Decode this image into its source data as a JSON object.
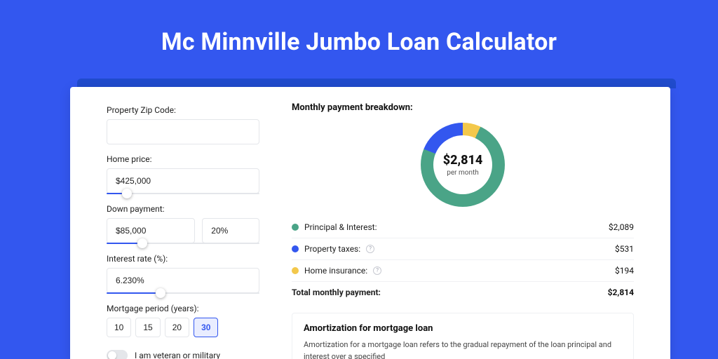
{
  "page_title": "Mc Minnville Jumbo Loan Calculator",
  "form": {
    "zip_label": "Property Zip Code:",
    "zip_value": "",
    "price_label": "Home price:",
    "price_value": "$425,000",
    "down_label": "Down payment:",
    "down_value": "$85,000",
    "down_pct": "20%",
    "rate_label": "Interest rate (%):",
    "rate_value": "6.230%",
    "period_label": "Mortgage period (years):",
    "periods": [
      "10",
      "15",
      "20",
      "30"
    ],
    "period_selected": "30",
    "veteran_label": "I am veteran or military"
  },
  "breakdown": {
    "title": "Monthly payment breakdown:",
    "donut_amount": "$2,814",
    "donut_sub": "per month",
    "rows": [
      {
        "label": "Principal & Interest:",
        "value": "$2,089",
        "color": "green",
        "info": false
      },
      {
        "label": "Property taxes:",
        "value": "$531",
        "color": "blue",
        "info": true
      },
      {
        "label": "Home insurance:",
        "value": "$194",
        "color": "yellow",
        "info": true
      }
    ],
    "total_label": "Total monthly payment:",
    "total_value": "$2,814"
  },
  "amortization": {
    "title": "Amortization for mortgage loan",
    "text": "Amortization for a mortgage loan refers to the gradual repayment of the loan principal and interest over a specified"
  },
  "chart_data": {
    "type": "pie",
    "title": "Monthly payment breakdown",
    "series": [
      {
        "name": "Principal & Interest",
        "value": 2089,
        "color": "#4aa487"
      },
      {
        "name": "Property taxes",
        "value": 531,
        "color": "#3357ef"
      },
      {
        "name": "Home insurance",
        "value": 194,
        "color": "#f3c84b"
      }
    ],
    "total": 2814,
    "unit": "USD per month"
  }
}
